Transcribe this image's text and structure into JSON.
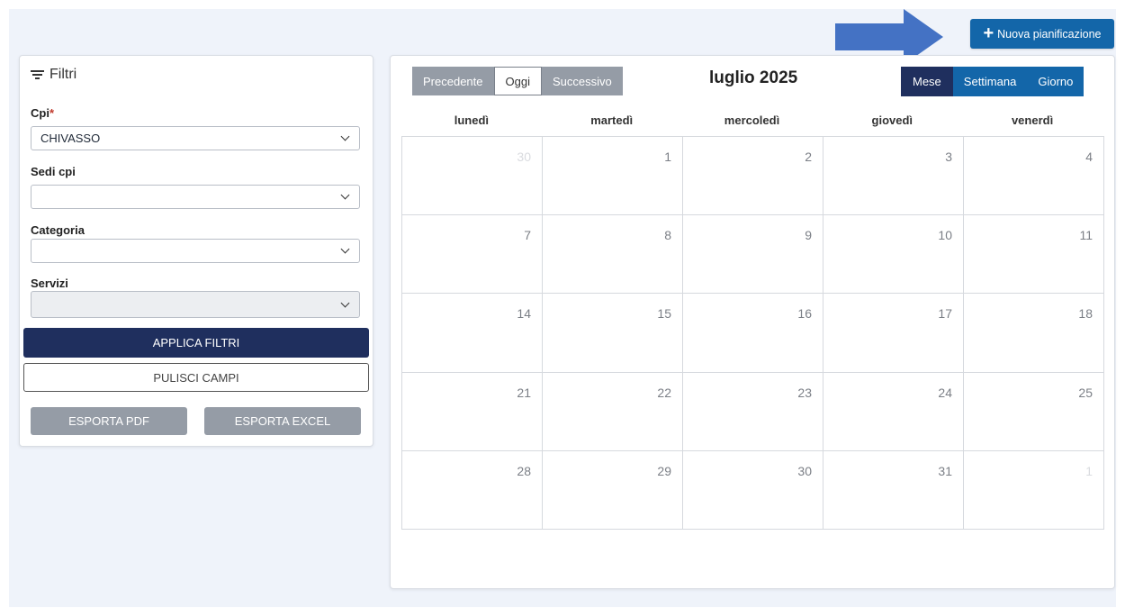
{
  "header": {
    "new_button_label": "Nuova pianificazione",
    "new_button_icon": "plus-icon",
    "annotation_icon": "arrow-right-icon",
    "annotation_color": "#4472c4"
  },
  "filters": {
    "title": "Filtri",
    "title_icon": "filter-icon",
    "cpi": {
      "label": "Cpi",
      "required_mark": "*",
      "value": "CHIVASSO"
    },
    "sedi": {
      "label": "Sedi cpi",
      "value": ""
    },
    "categoria": {
      "label": "Categoria",
      "value": ""
    },
    "servizi": {
      "label": "Servizi",
      "value": ""
    },
    "apply_label": "APPLICA FILTRI",
    "clear_label": "PULISCI CAMPI",
    "export_pdf_label": "ESPORTA PDF",
    "export_excel_label": "ESPORTA EXCEL"
  },
  "calendar": {
    "prev_label": "Precedente",
    "today_label": "Oggi",
    "next_label": "Successivo",
    "title": "luglio 2025",
    "views": [
      "Mese",
      "Settimana",
      "Giorno"
    ],
    "active_view": "Mese",
    "weekdays": [
      "lunedì",
      "martedì",
      "mercoledì",
      "giovedì",
      "venerdì"
    ],
    "weeks": [
      [
        {
          "d": "30",
          "muted": true
        },
        {
          "d": "1"
        },
        {
          "d": "2"
        },
        {
          "d": "3"
        },
        {
          "d": "4"
        }
      ],
      [
        {
          "d": "7"
        },
        {
          "d": "8"
        },
        {
          "d": "9"
        },
        {
          "d": "10"
        },
        {
          "d": "11"
        }
      ],
      [
        {
          "d": "14"
        },
        {
          "d": "15"
        },
        {
          "d": "16"
        },
        {
          "d": "17"
        },
        {
          "d": "18"
        }
      ],
      [
        {
          "d": "21"
        },
        {
          "d": "22"
        },
        {
          "d": "23"
        },
        {
          "d": "24"
        },
        {
          "d": "25"
        }
      ],
      [
        {
          "d": "28"
        },
        {
          "d": "29"
        },
        {
          "d": "30"
        },
        {
          "d": "31"
        },
        {
          "d": "1",
          "muted": true
        }
      ]
    ]
  },
  "colors": {
    "primary": "#1366a9",
    "dark_navy": "#1f2f5e",
    "muted_gray": "#959ca6",
    "background": "#eff3fa"
  }
}
